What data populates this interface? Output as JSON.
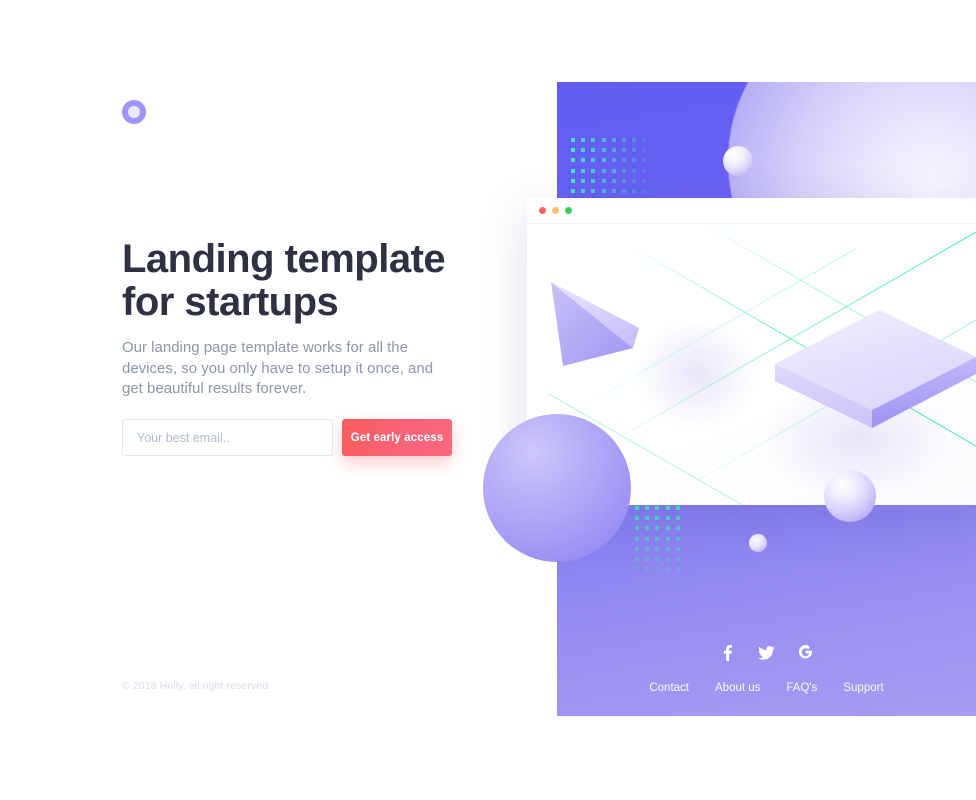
{
  "brand": {
    "logo_icon": "ring-logo-icon",
    "accent_purple": "#615DF2",
    "accent_periwinkle": "#A79DF3",
    "accent_coral": "#FA5F6E",
    "accent_mint": "#3EE8BD",
    "heading_color": "#2D3142",
    "body_color": "#8D96AB"
  },
  "hero": {
    "headline": "Landing template for startups",
    "subtext": "Our landing page template works for all the devices, so you only have to setup it once, and get beautiful results forever.",
    "form": {
      "email_placeholder": "Your best email..",
      "email_value": "",
      "cta_label": "Get early access"
    }
  },
  "footer": {
    "copyright": "© 2018 Holly, all right reserved"
  },
  "showcase": {
    "browser": {
      "traffic_lights": [
        {
          "name": "close-dot",
          "color": "#FC5F5F"
        },
        {
          "name": "minimize-dot",
          "color": "#FCC06A"
        },
        {
          "name": "maximize-dot",
          "color": "#3CCF57"
        }
      ],
      "shapes": [
        "tetrahedron",
        "isometric-box",
        "sphere"
      ],
      "grid_line_color": "#3EE8BD"
    },
    "decor": {
      "dot_grid_color": "#3EE8BD",
      "dot_grid_top_cols": 10,
      "dot_grid_top_rows": 6,
      "dot_grid_bottom_cols": 5,
      "dot_grid_bottom_rows": 9,
      "spheres": 4
    },
    "social": [
      {
        "name": "facebook-icon",
        "glyph": "f"
      },
      {
        "name": "twitter-icon",
        "glyph": "twitter"
      },
      {
        "name": "google-icon",
        "glyph": "G"
      }
    ],
    "nav_links": [
      {
        "label": "Contact"
      },
      {
        "label": "About us"
      },
      {
        "label": "FAQ's"
      },
      {
        "label": "Support"
      }
    ]
  }
}
